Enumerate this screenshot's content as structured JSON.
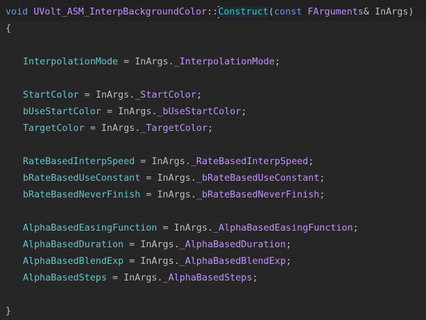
{
  "code": {
    "signature": {
      "kw_void": "void",
      "class_name": "UVolt_ASM_InterpBackgroundColor",
      "scope": "::",
      "method": "Construct",
      "open_paren": "(",
      "kw_const": "const",
      "param_type": "FArguments",
      "amp": "&",
      "param_name": "InArgs",
      "close_paren": ")"
    },
    "open_brace": "{",
    "close_brace": "}",
    "assignments": [
      {
        "lhs": "InterpolationMode",
        "obj": "InArgs",
        "rhs": "_InterpolationMode"
      },
      {
        "lhs": "StartColor",
        "obj": "InArgs",
        "rhs": "_StartColor"
      },
      {
        "lhs": "bUseStartColor",
        "obj": "InArgs",
        "rhs": "_bUseStartColor"
      },
      {
        "lhs": "TargetColor",
        "obj": "InArgs",
        "rhs": "_TargetColor"
      },
      {
        "lhs": "RateBasedInterpSpeed",
        "obj": "InArgs",
        "rhs": "_RateBasedInterpSpeed"
      },
      {
        "lhs": "bRateBasedUseConstant",
        "obj": "InArgs",
        "rhs": "_bRateBasedUseConstant"
      },
      {
        "lhs": "bRateBasedNeverFinish",
        "obj": "InArgs",
        "rhs": "_bRateBasedNeverFinish"
      },
      {
        "lhs": "AlphaBasedEasingFunction",
        "obj": "InArgs",
        "rhs": "_AlphaBasedEasingFunction"
      },
      {
        "lhs": "AlphaBasedDuration",
        "obj": "InArgs",
        "rhs": "_AlphaBasedDuration"
      },
      {
        "lhs": "AlphaBasedBlendExp",
        "obj": "InArgs",
        "rhs": "_AlphaBasedBlendExp"
      },
      {
        "lhs": "AlphaBasedSteps",
        "obj": "InArgs",
        "rhs": "_AlphaBasedSteps"
      }
    ],
    "eq": " = ",
    "dot": ".",
    "semi": ";"
  },
  "colors": {
    "background": "#262626",
    "current_line": "#212121",
    "keyword": "#6c95eb",
    "type": "#c191ff",
    "method": "#39cc9b",
    "field": "#66c3cc",
    "text": "#bdbdbd"
  }
}
